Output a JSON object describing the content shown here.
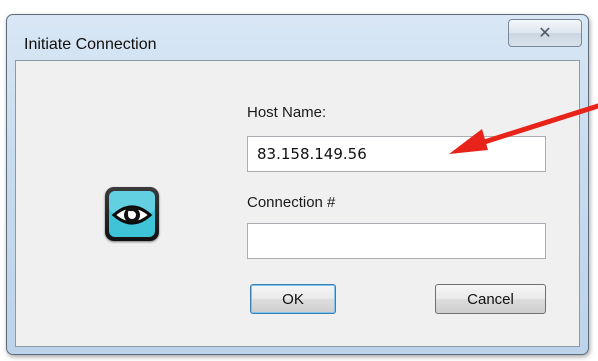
{
  "window": {
    "title": "Initiate Connection",
    "close_glyph": "✕",
    "close_icon": "close-icon"
  },
  "app_icon": {
    "icon": "eye-icon",
    "colors": {
      "tile": "#1a1a1a",
      "lens": "#3fc3d6",
      "lens_edge": "#0f6f80"
    }
  },
  "form": {
    "host_label": "Host Name:",
    "host_value": "83.158.149.56",
    "connection_label": "Connection #",
    "connection_value": ""
  },
  "buttons": {
    "ok_label": "OK",
    "cancel_label": "Cancel"
  },
  "annotation": {
    "icon": "arrow-icon",
    "color": "#e8231a"
  }
}
